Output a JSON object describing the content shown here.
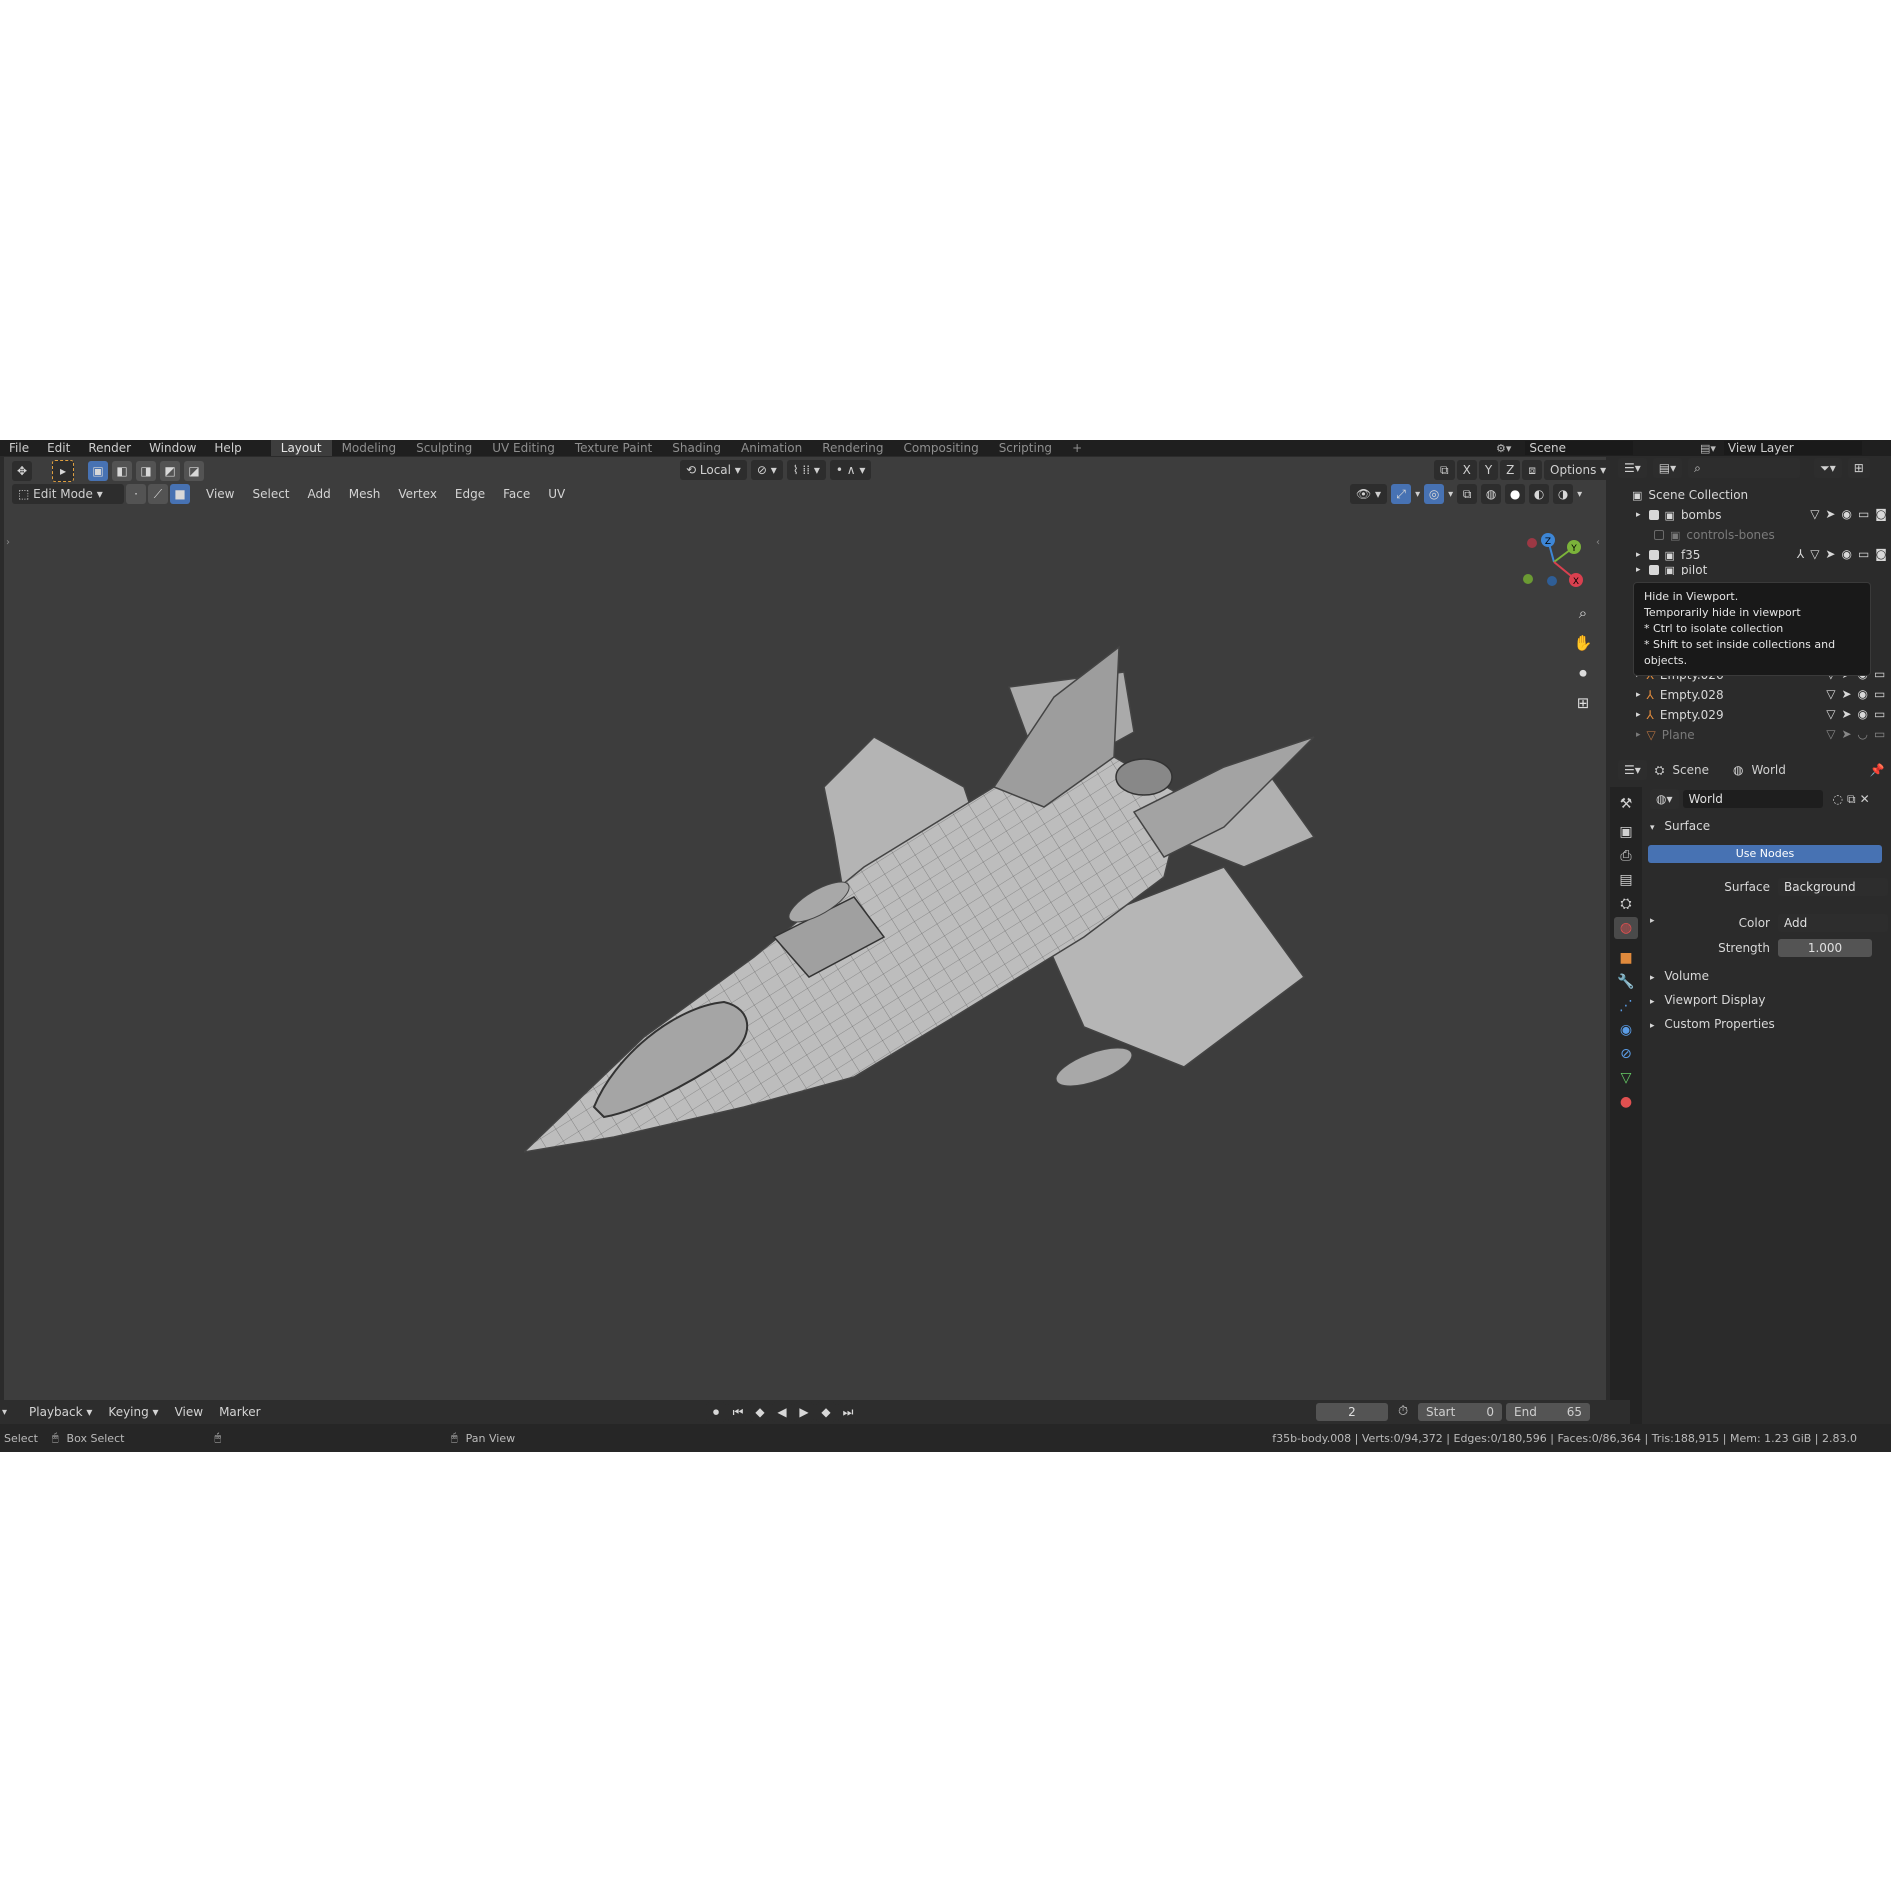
{
  "menu": {
    "items": [
      "File",
      "Edit",
      "Render",
      "Window",
      "Help"
    ]
  },
  "workspaces": {
    "tabs": [
      "Layout",
      "Modeling",
      "Sculpting",
      "UV Editing",
      "Texture Paint",
      "Shading",
      "Animation",
      "Rendering",
      "Compositing",
      "Scripting"
    ],
    "add": "+"
  },
  "scene_selector": {
    "scene": "Scene",
    "view_layer": "View Layer"
  },
  "viewport": {
    "mode": "Edit Mode",
    "menus": [
      "View",
      "Select",
      "Add",
      "Mesh",
      "Vertex",
      "Edge",
      "Face",
      "UV"
    ],
    "transform_orientation": "Local",
    "axis_x": "X",
    "axis_y": "Y",
    "axis_z": "Z",
    "options": "Options",
    "gizmo": {
      "x": "X",
      "y": "Y",
      "z": "Z"
    }
  },
  "outliner": {
    "root": "Scene Collection",
    "rows": [
      "bombs",
      "controls-bones",
      "f35",
      "pilot",
      "Empty.026",
      "Empty.028",
      "Empty.029",
      "Plane"
    ]
  },
  "tooltip": {
    "title": "Hide in Viewport.",
    "line1": "Temporarily hide in viewport",
    "line2": "* Ctrl to isolate collection",
    "line3": "* Shift to set inside collections and objects."
  },
  "properties": {
    "breadcrumb_scene": "Scene",
    "breadcrumb_world": "World",
    "world_name": "World",
    "surface_panel": "Surface",
    "use_nodes": "Use Nodes",
    "surface_label": "Surface",
    "surface_value": "Background",
    "color_label": "Color",
    "color_value": "Add",
    "strength_label": "Strength",
    "strength_value": "1.000",
    "panels": [
      "Volume",
      "Viewport Display",
      "Custom Properties"
    ]
  },
  "timeline": {
    "menus": [
      "Playback",
      "Keying",
      "View",
      "Marker"
    ],
    "current_frame": "2",
    "start_label": "Start",
    "start": "0",
    "end_label": "End",
    "end": "65"
  },
  "status": {
    "select": "Select",
    "box_select": "Box Select",
    "pan_view": "Pan View",
    "stats": "f35b-body.008 | Verts:0/94,372 | Edges:0/180,596 | Faces:0/86,364 | Tris:188,915 | Mem: 1.23 GiB | 2.83.0"
  },
  "colors": {
    "accent": "#4772b3",
    "viewport_bg": "#3d3d3d",
    "panel_bg": "#2b2b2b",
    "axis_x": "#d9404f",
    "axis_y": "#7bb33a",
    "axis_z": "#3d86d6"
  }
}
